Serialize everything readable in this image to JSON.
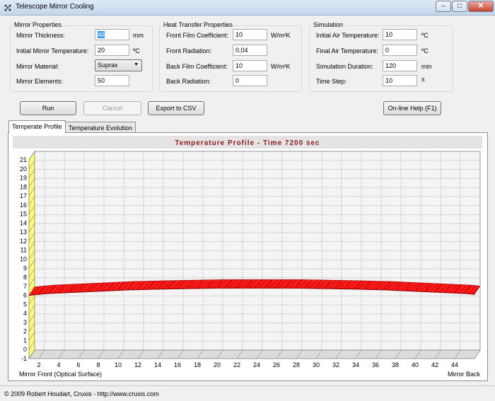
{
  "window": {
    "title": "Telescope Mirror Cooling"
  },
  "mirror_properties": {
    "title": "Mirror Properties",
    "thickness": {
      "label": "Mirror Thickness:",
      "value": "46",
      "unit": "mm"
    },
    "initial_temp": {
      "label": "Initial Mirror Temperature:",
      "value": "20",
      "unit": "ºC"
    },
    "material": {
      "label": "Mirror Material:",
      "value": "Suprax"
    },
    "elements": {
      "label": "Mirror Elements:",
      "value": "50"
    }
  },
  "heat_transfer": {
    "title": "Heat Transfer Properties",
    "front_film": {
      "label": "Front Film Coefficient:",
      "value": "10",
      "unit": "W/m²K"
    },
    "front_radiation": {
      "label": "Front Radiation:",
      "value": "0,04"
    },
    "back_film": {
      "label": "Back Film Coefficient:",
      "value": "10",
      "unit": "W/m²K"
    },
    "back_radiation": {
      "label": "Back Radiation:",
      "value": "0"
    }
  },
  "simulation": {
    "title": "Simulation",
    "initial_air": {
      "label": "Initial Air Temperature:",
      "value": "10",
      "unit": "ºC"
    },
    "final_air": {
      "label": "Final Air Temperature:",
      "value": "0",
      "unit": "ºC"
    },
    "duration": {
      "label": "Simulation Duration:",
      "value": "120",
      "unit": "min"
    },
    "time_step": {
      "label": "Time Step:",
      "value": "10",
      "unit": "s"
    }
  },
  "buttons": {
    "run": "Run",
    "cancel": "Cancel",
    "export": "Export to CSV",
    "help": "On-line Help (F1)"
  },
  "tabs": [
    {
      "label": "Temperate Profile",
      "active": true
    },
    {
      "label": "Temperature Evolution",
      "active": false
    }
  ],
  "chart_data": {
    "type": "area",
    "title": "Temperature Profile - Time 7200 sec",
    "x_start_label": "Mirror Front (Optical Surface)",
    "x_end_label": "Mirror Back",
    "x_ticks": [
      2,
      4,
      6,
      8,
      10,
      12,
      14,
      16,
      18,
      20,
      22,
      24,
      26,
      28,
      30,
      32,
      34,
      36,
      38,
      40,
      42,
      44
    ],
    "y_ticks": [
      -1,
      0,
      1,
      2,
      3,
      4,
      5,
      6,
      7,
      8,
      9,
      10,
      11,
      12,
      13,
      14,
      15,
      16,
      17,
      18,
      19,
      20,
      21
    ],
    "ylim": [
      -1,
      21
    ],
    "xlim": [
      1,
      46
    ],
    "grid": true,
    "series": [
      {
        "color": "#ff0000",
        "x": [
          1,
          2,
          3,
          4,
          5,
          6,
          7,
          8,
          9,
          10,
          11,
          12,
          13,
          14,
          15,
          16,
          17,
          18,
          19,
          20,
          21,
          22,
          23,
          24,
          25,
          26,
          27,
          28,
          29,
          30,
          31,
          32,
          33,
          34,
          35,
          36,
          37,
          38,
          39,
          40,
          41,
          42,
          43,
          44,
          45,
          46
        ],
        "values": [
          6.0,
          6.1,
          6.2,
          6.25,
          6.3,
          6.35,
          6.4,
          6.45,
          6.5,
          6.55,
          6.6,
          6.62,
          6.65,
          6.68,
          6.7,
          6.72,
          6.74,
          6.76,
          6.78,
          6.8,
          6.8,
          6.8,
          6.8,
          6.8,
          6.8,
          6.8,
          6.8,
          6.8,
          6.78,
          6.76,
          6.74,
          6.72,
          6.7,
          6.68,
          6.65,
          6.62,
          6.6,
          6.55,
          6.5,
          6.45,
          6.4,
          6.35,
          6.3,
          6.25,
          6.2,
          6.1
        ]
      }
    ]
  },
  "status": {
    "text": "© 2009 Robert Houdart, Cruxis  -  http://www.cruxis.com"
  }
}
